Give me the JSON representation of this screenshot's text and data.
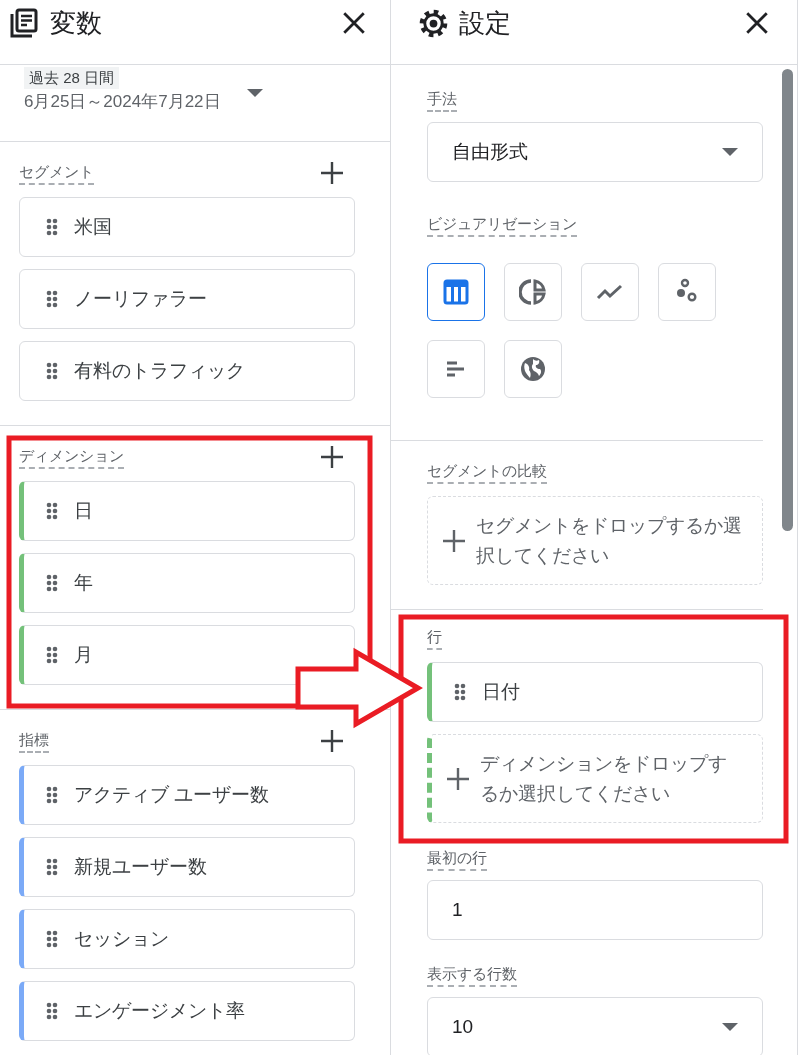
{
  "left_panel": {
    "title": "変数",
    "date_range": {
      "preset": "過去 28 日間",
      "range": "6月25日～2024年7月22日"
    },
    "sections": [
      {
        "kind": "segment",
        "title": "セグメント",
        "items": [
          "米国",
          "ノーリファラー",
          "有料のトラフィック"
        ]
      },
      {
        "kind": "dimension",
        "title": "ディメンション",
        "items": [
          "日",
          "年",
          "月"
        ]
      },
      {
        "kind": "metric",
        "title": "指標",
        "items": [
          "アクティブ ユーザー数",
          "新規ユーザー数",
          "セッション",
          "エンゲージメント率"
        ]
      }
    ]
  },
  "right_panel": {
    "title": "設定",
    "technique": {
      "label": "手法",
      "value": "自由形式"
    },
    "visualization": {
      "label": "ビジュアリゼーション",
      "options": [
        {
          "kind": "table",
          "selected": true
        },
        {
          "kind": "donut",
          "selected": false
        },
        {
          "kind": "line",
          "selected": false
        },
        {
          "kind": "scatter",
          "selected": false
        },
        {
          "kind": "bar",
          "selected": false
        },
        {
          "kind": "geo",
          "selected": false
        }
      ]
    },
    "segment_comparison": {
      "label": "セグメントの比較",
      "placeholder": "セグメントをドロップするか選択してください"
    },
    "rows": {
      "label": "行",
      "items": [
        {
          "kind": "dimension",
          "name": "日付"
        }
      ],
      "placeholder": "ディメンションをドロップするか選択してください"
    },
    "first_row": {
      "label": "最初の行",
      "value": "1"
    },
    "rows_shown": {
      "label": "表示する行数",
      "value": "10"
    }
  },
  "annotations": [
    {
      "kind": "box"
    },
    {
      "kind": "box"
    },
    {
      "kind": "arrow"
    }
  ]
}
